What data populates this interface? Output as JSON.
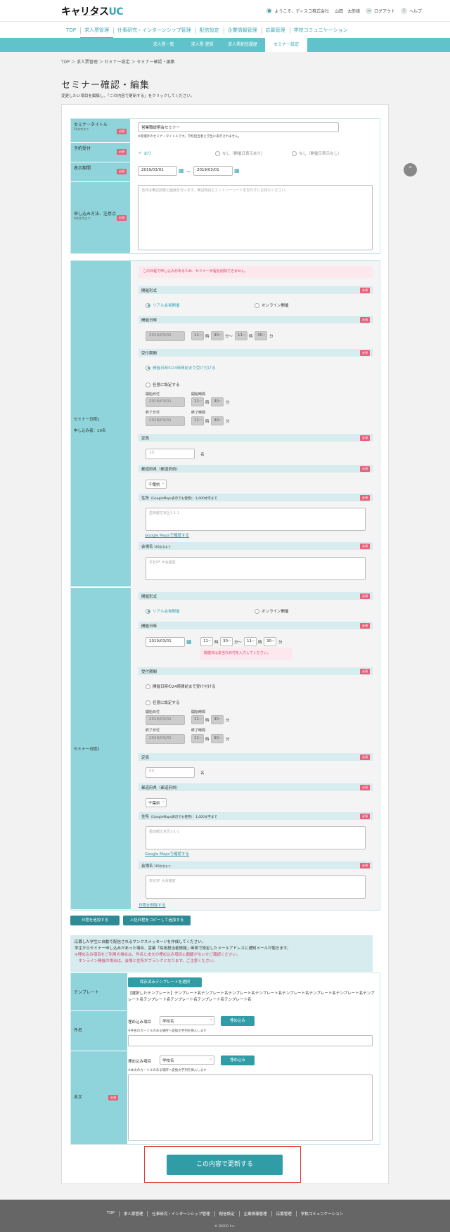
{
  "header": {
    "logo_main": "キャリタス",
    "logo_accent": "UC",
    "logo_sub": "CAREERTASU",
    "welcome": "ようこそ、ディスコ株式会社",
    "user": "山田　太郎様",
    "logout": "ログアウト",
    "help": "ヘルプ"
  },
  "gnav": [
    "TOP",
    "求人票管理",
    "仕事研究・インターンシップ管理",
    "配信設定",
    "企業情報管理",
    "応募管理",
    "学校コミュニケーション"
  ],
  "subnav": [
    "求人票一覧",
    "求人票 登録",
    "求人票配信履歴",
    "セミナー設定"
  ],
  "breadcrumb": "TOP ＞ 求人票管理 ＞ セミナー設定 ＞ セミナー確認・編集",
  "page": {
    "title": "セミナー確認・編集",
    "desc": "変更したい項目を編集し、「この内容で更新する」をクリックしてください。"
  },
  "required": "必須",
  "basic": {
    "title_label": "セミナータイトル",
    "title_sub": "50文字まで",
    "title_value": "営業職説明会セミナー",
    "title_note": "※管理外のセミナータイトルです。学校担当者と学生に表示されません。",
    "reserve_label": "予約受付",
    "reserve_on": "あり",
    "reserve_off1": "なし（開催日表示あり）",
    "reserve_off2": "なし（開催日表示なし）",
    "period_label": "表示期間",
    "period_from": "2019/03/01",
    "period_tilde": "〜",
    "period_to": "2019/03/01",
    "apply_label": "申し込み方法、注意点",
    "apply_sub": "600文字まで",
    "apply_placeholder": "当日は筆記試験と面接を行います。筆記用具とエントリーシートを忘れずにお持ちください。"
  },
  "schedule1": {
    "label": "セミナー日程1",
    "count": "申し込み者：10名",
    "warning": "この日程で申し込みがあるため、セミナー日程を削除できません。",
    "format_label": "開催形式",
    "format_real": "リアル会場開催",
    "format_online": "オンライン開催",
    "datetime_label": "開催日時",
    "date": "2019/03/01",
    "h1": "11",
    "m1": "30",
    "h2": "11",
    "m2": "30",
    "hour_unit": "時",
    "min_unit": "分",
    "tilde": "〜",
    "accept_label": "受付期間",
    "accept_opt1": "開催日時の24時間前まで受け付ける",
    "accept_opt2": "任意に設定する",
    "start_date_label": "開始日付",
    "start_time_label": "開始時間",
    "end_date_label": "終了日付",
    "end_time_label": "終了時間",
    "start_date": "2019/03/01",
    "end_date": "2019/03/01",
    "sh": "11",
    "sm": "30",
    "eh": "11",
    "em": "30",
    "capacity_label": "定員",
    "capacity_placeholder": "10",
    "capacity_unit": "名",
    "pref_label": "都道府県（都道府県）",
    "pref_value": "千葉県",
    "address_label": "住所",
    "address_sub": "（GoogleMaps表示でも使用）：1,000文字まで",
    "address_placeholder": "墨田都文京区1-1-1",
    "map_link": "Google Mapsで確認する",
    "venue_label": "会場名",
    "venue_sub": "100文字まで",
    "venue_placeholder": "本社5F 大会議室"
  },
  "schedule2": {
    "label": "セミナー日程2",
    "format_label": "開催形式",
    "format_real": "リアル会場開催",
    "format_online": "オンライン開催",
    "datetime_label": "開催日時",
    "date": "2019/03/01",
    "h1": "11",
    "m1": "30",
    "h2": "11",
    "m2": "30",
    "hour_unit": "時",
    "min_unit": "分",
    "tilde": "〜",
    "error": "開催日は妥当な日付を入力してください。",
    "accept_label": "受付期間",
    "accept_opt1": "開催日時の24時間前まで受け付ける",
    "accept_opt2": "任意に設定する",
    "start_date_label": "開始日付",
    "start_time_label": "開始時間",
    "end_date_label": "終了日付",
    "end_time_label": "終了時間",
    "start_date": "2019/03/01",
    "end_date": "2019/03/01",
    "sh": "11",
    "sm": "30",
    "eh": "11",
    "em": "30",
    "capacity_label": "定員",
    "capacity_placeholder": "50",
    "capacity_unit": "名",
    "pref_label": "都道府県（都道府県）",
    "pref_value": "千葉県",
    "address_label": "住所",
    "address_sub": "（GoogleMaps表示でも使用）：1,000文字まで",
    "address_placeholder": "墨田都文京区1-1-1",
    "map_link": "Google Mapsで確認する",
    "venue_label": "会場名",
    "venue_sub": "100文字まで",
    "venue_placeholder": "本社5F 大会議室",
    "delete_link": "日程を削除する"
  },
  "buttons": {
    "add_schedule": "日程を追加する",
    "copy_schedule": "上記日程をコピーして追加する",
    "submit": "この内容で更新する"
  },
  "mail": {
    "info1": "応募した学生に自動で配信されるサンクスメッセージを作成してください。",
    "info2": "学生からセミナー申し込みがあった場合、営業「採用担当者情報」画面で設定したメールアドレスに通知メールが届きます。",
    "info3": "※埋め込み項目をご利用の場合は、件名と本文の埋め込み項目に齟齬がないかご確認ください。",
    "info4": "　オンライン開催の場合は、会場と住所がブランクとなります。ご注意ください。",
    "template_label": "テンプレート",
    "template_button": "保存済みテンプレートを選択",
    "template_text": "【選択したテンプレート】テンプレート名テンプレート名テンプレート名テンプレート名テンプレート名テンプレート名テンプレート名テンプレート名テンプレート名テンプレート名テンプレート名テンプレート名",
    "subject_label": "件名",
    "embed_label": "埋め込み項目",
    "embed_value": "学校名",
    "embed_button": "埋め込み",
    "subject_note": "※件名のカーソルのある場所へ変換文字列を挿入します",
    "body_label": "本文",
    "body_note": "※本文のカーソルのある場所へ変換文字列を挿入します"
  },
  "footer": {
    "links": [
      "TOP",
      "求人票管理",
      "仕事研究・インターンシップ管理",
      "配信設定",
      "企業情報管理",
      "応募管理",
      "学校コミュニケーション"
    ],
    "copy": "© DISCO Inc."
  },
  "colors": {
    "accent": "#3aa6b3",
    "label_bg": "#8ed4da",
    "required": "#e8607a",
    "button": "#2f9ca6",
    "error": "#d8406a"
  }
}
